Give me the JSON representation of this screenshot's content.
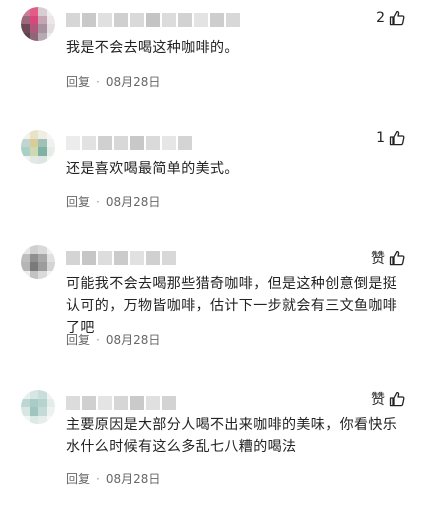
{
  "comments": [
    {
      "like_text": "2",
      "text": "我是不会去喝这种咖啡的。",
      "reply_label": "回复",
      "separator": "·",
      "date": "08月28日",
      "avatar_colors": [
        "#c97d93",
        "#e35b86",
        "#d7cdd2",
        "#f2eef0",
        "#9a6a7c",
        "#d8467a",
        "#c5a5b1",
        "#ece6e9",
        "#6e4a58",
        "#b05878",
        "#a992a0",
        "#e3dde0",
        "#5a4450",
        "#8e6678",
        "#b8aab2",
        "#efeaed"
      ],
      "name_colors": [
        "#d6d6d6",
        "#c9c9c9",
        "#e0e0e0",
        "#cfcfcf",
        "#d9d9d9",
        "#c4c4c4",
        "#dcdcdc",
        "#d2d2d2",
        "#e3e3e3",
        "#cdcdcd",
        "#d8d8d8"
      ]
    },
    {
      "like_text": "1",
      "text": "还是喜欢喝最简单的美式。",
      "reply_label": "回复",
      "separator": "·",
      "date": "08月28日",
      "avatar_colors": [
        "#f3f1ea",
        "#e8e2c8",
        "#f1ede2",
        "#f7f6f2",
        "#bfd5cf",
        "#d8cc9a",
        "#9fc1b6",
        "#eef1ee",
        "#a9cfc6",
        "#cfd9b0",
        "#7fb1a5",
        "#e7ece8",
        "#f0f2ef",
        "#e2e8e3",
        "#dfe6e1",
        "#f6f7f5"
      ],
      "name_colors": [
        "#ececec",
        "#e2e2e2",
        "#d0d0d0",
        "#d8d8d8",
        "#c8c8c8",
        "#dadada",
        "#e6e6e6",
        "#d4d4d4"
      ]
    },
    {
      "like_text": "赞",
      "text": "可能我不会去喝那些猎奇咖啡，但是这种创意倒是挺认可的，万物皆咖啡，估计下一步就会有三文鱼咖啡了吧",
      "reply_label": "回复",
      "separator": "·",
      "date": "08月28日",
      "avatar_colors": [
        "#e6e6e6",
        "#cfcfcf",
        "#d9d9d9",
        "#f0f0f0",
        "#bdbdbd",
        "#8f8f8f",
        "#a8a8a8",
        "#e0e0e0",
        "#b5b5b5",
        "#7a7a7a",
        "#9c9c9c",
        "#d4d4d4",
        "#ededed",
        "#c2c2c2",
        "#dadada",
        "#f3f3f3"
      ],
      "name_colors": [
        "#d4d4d4",
        "#c6c6c6",
        "#dddddd",
        "#cbcbcb",
        "#e1e1e1",
        "#d0d0d0",
        "#d8d8d8"
      ]
    },
    {
      "like_text": "赞",
      "text": "主要原因是大部分人喝不出来咖啡的美味，你看快乐水什么时候有这么多乱七八糟的喝法",
      "reply_label": "回复",
      "separator": "·",
      "date": "08月28日",
      "avatar_colors": [
        "#e8efee",
        "#d5e6e4",
        "#c9dedb",
        "#eef3f2",
        "#bcd7d3",
        "#a9ccc7",
        "#b7d3cf",
        "#e4ecea",
        "#d8e7e4",
        "#9fc5bf",
        "#c3dad6",
        "#edf2f1",
        "#f1f5f4",
        "#dde9e7",
        "#e6eeec",
        "#f5f8f7"
      ],
      "name_colors": [
        "#dcdcdc",
        "#d0d0d0",
        "#e4e4e4",
        "#d6d6d6",
        "#cacaca",
        "#e0e0e0",
        "#d3d3d3"
      ]
    }
  ]
}
